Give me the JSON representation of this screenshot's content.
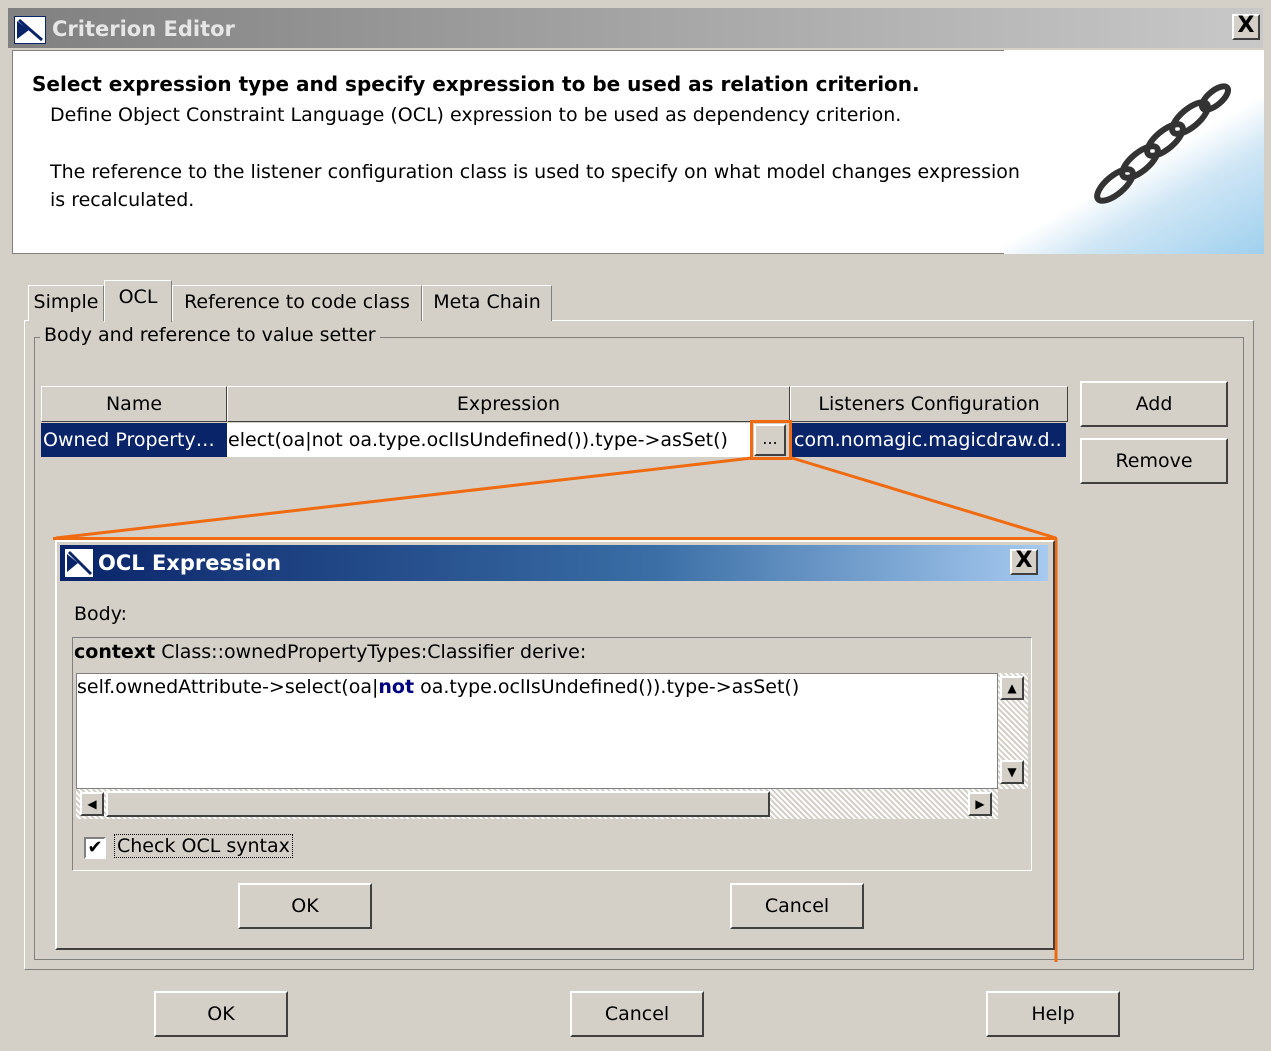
{
  "window": {
    "title": "Criterion Editor",
    "close_label": "X"
  },
  "header": {
    "title": "Select expression type and specify expression to be used as relation criterion.",
    "description": "Define Object Constraint Language (OCL) expression to be used as dependency criterion.",
    "note": "The reference to the listener configuration class is used to specify on what model changes expression is recalculated."
  },
  "tabs": [
    {
      "label": "Simple",
      "active": false
    },
    {
      "label": "OCL",
      "active": true
    },
    {
      "label": "Reference to code class",
      "active": false
    },
    {
      "label": "Meta Chain",
      "active": false
    }
  ],
  "group": {
    "label": "Body and reference to value setter"
  },
  "table": {
    "columns": [
      "Name",
      "Expression",
      "Listeners Configuration"
    ],
    "rows": [
      {
        "name": "Owned Property…",
        "expression": "elect(oa|not oa.type.oclIsUndefined()).type->asSet()",
        "ellipsis": "...",
        "listeners": "com.nomagic.magicdraw.d.."
      }
    ]
  },
  "side_buttons": {
    "add": "Add",
    "remove": "Remove"
  },
  "ocl_dialog": {
    "title": "OCL Expression",
    "close_label": "X",
    "body_label": "Body:",
    "context_keyword": "context",
    "context_rest": " Class::ownedPropertyTypes:Classifier derive:",
    "expression_part1": "self.ownedAttribute->select(oa|",
    "expression_keyword": "not",
    "expression_part2": " oa.type.oclIsUndefined()).type->asSet()",
    "check_syntax_label": "Check OCL syntax",
    "check_syntax_checked": true,
    "ok": "OK",
    "cancel": "Cancel"
  },
  "footer": {
    "ok": "OK",
    "cancel": "Cancel",
    "help": "Help"
  },
  "colors": {
    "selection": "#0a246a",
    "callout": "#f06a10",
    "keyword": "#000080"
  }
}
